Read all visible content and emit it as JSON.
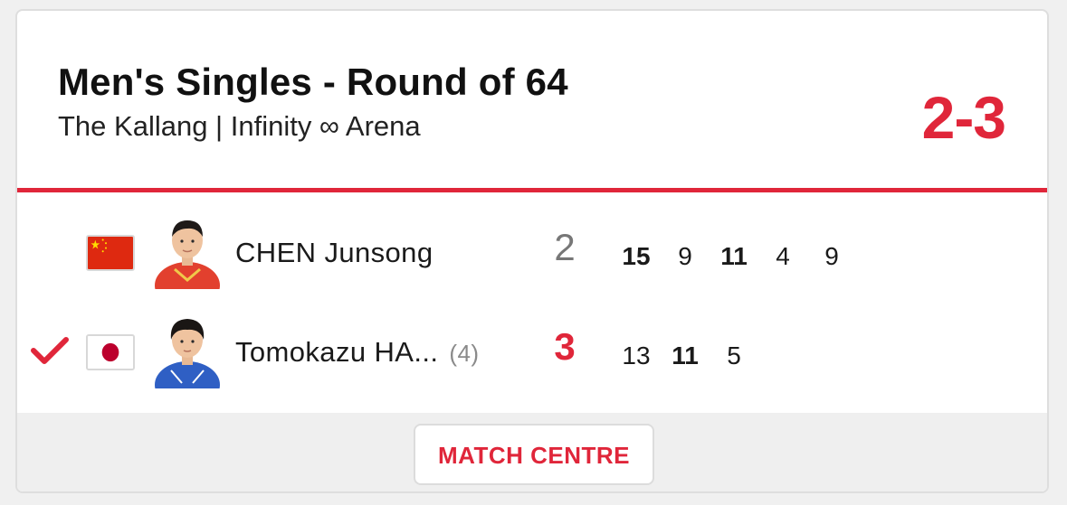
{
  "match": {
    "title": "Men's Singles - Round of 64",
    "venue": "The Kallang | Infinity ∞ Arena",
    "score": "2-3"
  },
  "players": [
    {
      "name": "CHEN Junsong",
      "seed": "",
      "flag": "china-flag",
      "games": "2",
      "winner": false,
      "sets": [
        "15",
        "9",
        "11",
        "4",
        "9"
      ],
      "bold_sets": [
        true,
        false,
        true,
        false,
        false
      ]
    },
    {
      "name": "Tomokazu HA...",
      "seed": "(4)",
      "flag": "japan-flag",
      "games": "3",
      "winner": true,
      "sets": [
        "13",
        "11",
        "5"
      ],
      "bold_sets": [
        false,
        true,
        false
      ]
    }
  ],
  "footer": {
    "match_centre_label": "MATCH CENTRE"
  },
  "colors": {
    "accent": "#e0263a",
    "text": "#111111",
    "muted": "#8a8a8a"
  }
}
